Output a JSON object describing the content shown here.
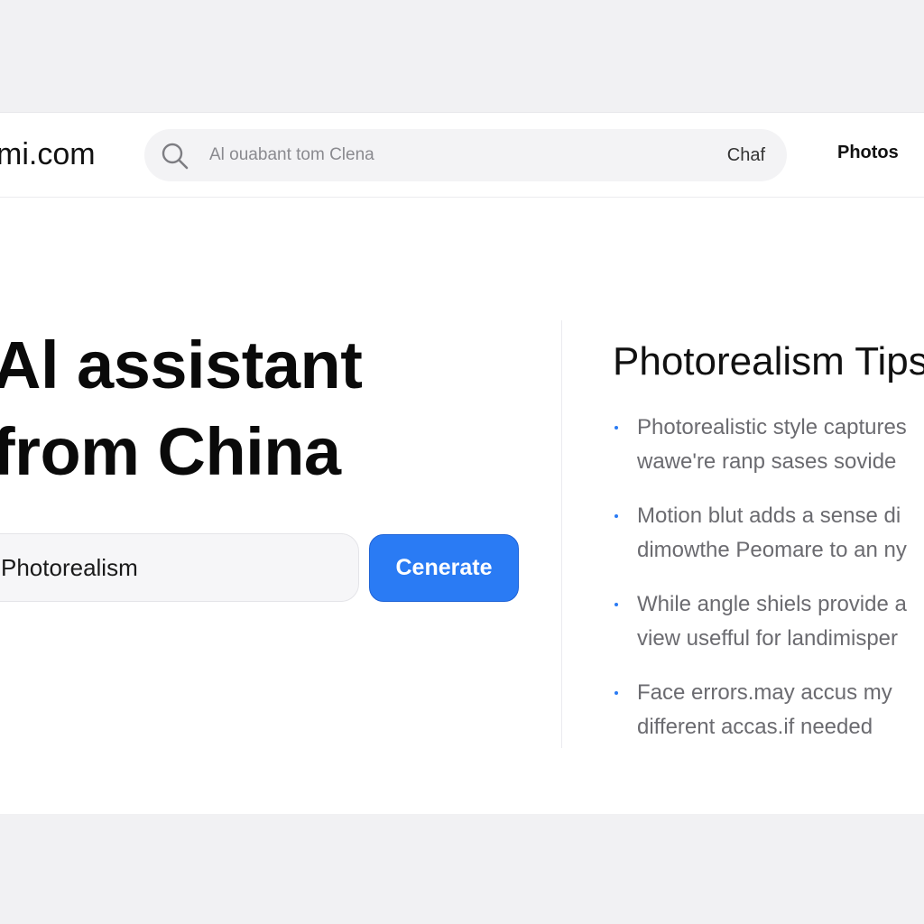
{
  "header": {
    "logo": "mi.com",
    "search": {
      "placeholder": "Al ouabant tom Clena",
      "chat_label": "Chaf"
    },
    "nav": {
      "photos": "Photos"
    }
  },
  "hero": {
    "title_line1": "Al assistant",
    "title_line2": "from China",
    "prompt_value": "Photorealism",
    "generate_label": "Cenerate"
  },
  "tips": {
    "title": "Photorealism Tips",
    "items": [
      {
        "line1": "Photorealistic style captures",
        "line2": "wawe're ranp sases sovide"
      },
      {
        "line1": "Motion blut adds a sense di",
        "line2": "dimowthe Peomare to an ny"
      },
      {
        "line1": "While angle shiels provide a",
        "line2": "view usefful for landimisper"
      },
      {
        "line1": "Face errors.may accus my",
        "line2": "different accas.if needed"
      }
    ]
  },
  "colors": {
    "accent": "#2a7bf4",
    "background": "#f1f1f3",
    "card": "#ffffff"
  },
  "icons": {
    "search": "search-icon",
    "bullet": "bullet-dot"
  }
}
